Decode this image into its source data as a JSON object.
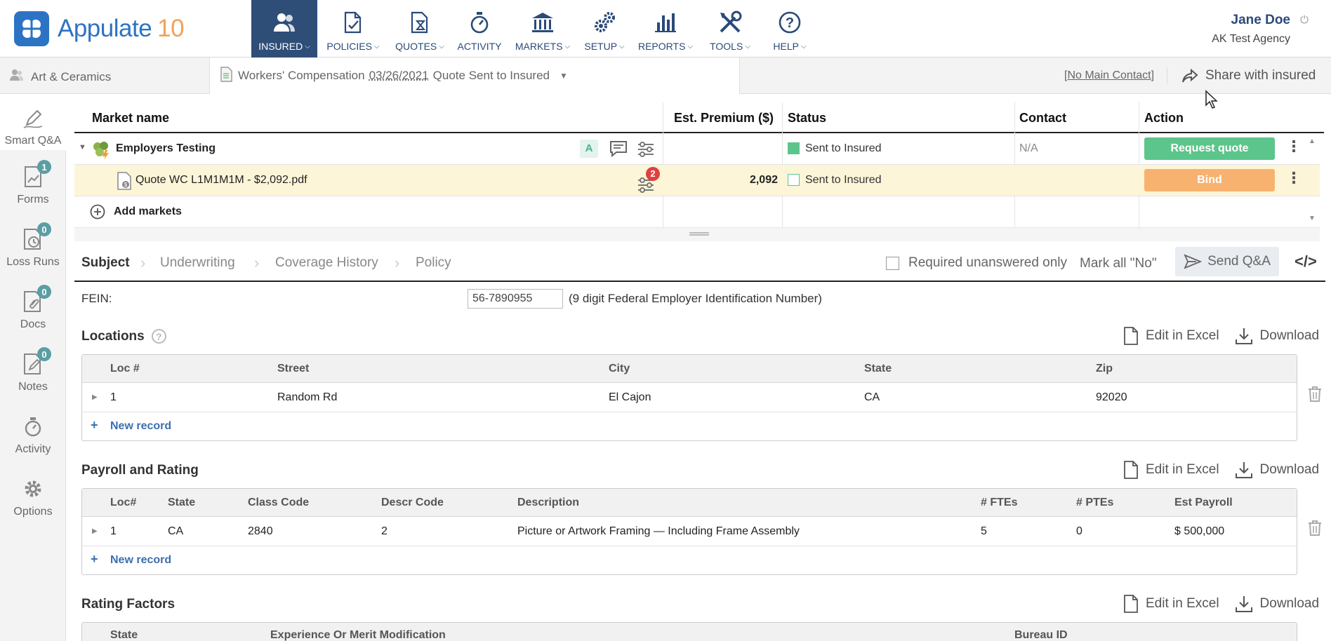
{
  "brand": {
    "name": "Appulate",
    "version": "10"
  },
  "nav": [
    {
      "label": "INSURED",
      "icon": "users-icon",
      "active": true
    },
    {
      "label": "POLICIES",
      "icon": "policy-icon"
    },
    {
      "label": "QUOTES",
      "icon": "quote-hourglass-icon"
    },
    {
      "label": "ACTIVITY",
      "icon": "stopwatch-icon"
    },
    {
      "label": "MARKETS",
      "icon": "bank-icon"
    },
    {
      "label": "SETUP",
      "icon": "gears-icon"
    },
    {
      "label": "REPORTS",
      "icon": "bar-chart-icon"
    },
    {
      "label": "TOOLS",
      "icon": "tools-icon"
    },
    {
      "label": "HELP",
      "icon": "help-icon"
    }
  ],
  "user": {
    "name": "Jane Doe",
    "agency": "AK Test Agency"
  },
  "subheader": {
    "insured": "Art & Ceramics",
    "policy_type": "Workers' Compensation",
    "policy_date": "03/26/2021",
    "policy_status": "Quote Sent to Insured",
    "no_contact": "No Main Contact",
    "share": "Share with insured"
  },
  "sidebar": [
    {
      "label": "Smart Q&A",
      "icon": "pen-icon"
    },
    {
      "label": "Forms",
      "icon": "form-chart-icon",
      "badge": "1"
    },
    {
      "label": "Loss Runs",
      "icon": "loss-runs-icon",
      "badge": "0"
    },
    {
      "label": "Docs",
      "icon": "docs-icon",
      "badge": "0"
    },
    {
      "label": "Notes",
      "icon": "notes-icon",
      "badge": "0"
    },
    {
      "label": "Activity",
      "icon": "activity-icon"
    },
    {
      "label": "Options",
      "icon": "gear-icon"
    }
  ],
  "markets": {
    "headers": {
      "name": "Market name",
      "premium": "Est. Premium ($)",
      "status": "Status",
      "contact": "Contact",
      "action": "Action"
    },
    "market": {
      "name": "Employers Testing",
      "badge": "A",
      "status": "Sent to Insured",
      "contact": "N/A",
      "action": "Request quote"
    },
    "quote": {
      "name": "Quote WC L1M1M1M - $2,092.pdf",
      "premium": "2,092",
      "status": "Sent to Insured",
      "action": "Bind",
      "notif": "2"
    },
    "add": "Add markets"
  },
  "qa_tabs": [
    "Subject",
    "Underwriting",
    "Coverage History",
    "Policy"
  ],
  "qa_tools": {
    "required_only": "Required unanswered only",
    "mark_no": "Mark all \"No\"",
    "send": "Send Q&A",
    "code": "</>"
  },
  "fein": {
    "label": "FEIN:",
    "value": "56-7890955",
    "hint": "(9 digit Federal Employer Identification Number)"
  },
  "tools": {
    "edit_excel": "Edit in Excel",
    "download": "Download",
    "new_record": "New record"
  },
  "locations": {
    "title": "Locations",
    "help": "?",
    "headers": [
      "Loc #",
      "Street",
      "City",
      "State",
      "Zip"
    ],
    "rows": [
      [
        "1",
        "Random Rd",
        "El Cajon",
        "CA",
        "92020"
      ]
    ]
  },
  "payroll": {
    "title": "Payroll and Rating",
    "headers": [
      "Loc#",
      "State",
      "Class Code",
      "Descr Code",
      "Description",
      "# FTEs",
      "# PTEs",
      "Est Payroll"
    ],
    "rows": [
      [
        "1",
        "CA",
        "2840",
        "2",
        "Picture or Artwork Framing — Including Frame Assembly",
        "5",
        "0",
        "$ 500,000"
      ]
    ]
  },
  "rating": {
    "title": "Rating Factors",
    "headers": [
      "State",
      "Experience Or Merit Modification",
      "Bureau ID"
    ]
  },
  "colors": {
    "nav_active": "#2e4e78",
    "brand": "#2d73c4",
    "request": "#5cc58b",
    "bind": "#f8b26f",
    "badge": "#5b9ea4"
  }
}
